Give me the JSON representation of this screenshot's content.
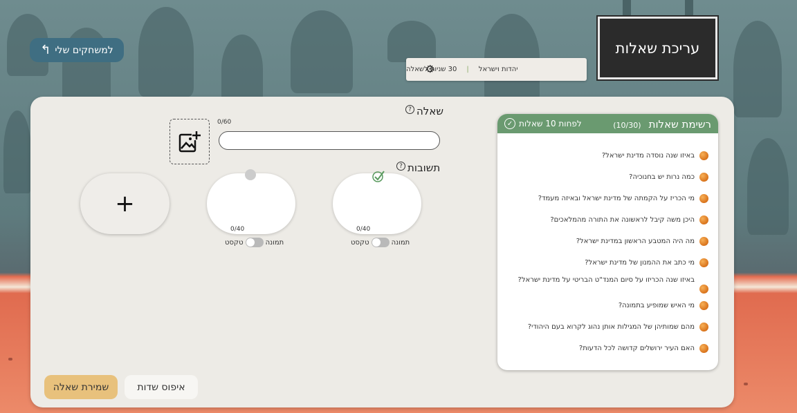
{
  "header": {
    "back_label": "למשחקים שלי",
    "title": "עריכת שאלות",
    "settings": {
      "category": "יהדות וישראל",
      "separator": "|",
      "time_per_question": "30 שניות לשאלה"
    }
  },
  "question_list": {
    "title": "רשימת שאלות",
    "count": "(10/30)",
    "minimum": "לפחות 10 שאלות",
    "items": [
      "באיזו שנה נוסדה מדינת ישראל?",
      "כמה נרות יש בחנוכיה?",
      "מי הכריז על הקמתה של מדינת ישראל ובאיזה מעמד?",
      "היכן משה קיבל לראשונה את התורה מהמלאכים?",
      "מה היה המטבע הראשון במדינת ישראל?",
      "מי כתב את ההמנון של מדינת ישראל?",
      "באיזו שנה הכריזו על סיום המנד\"ט הבריטי על מדינת ישראל?",
      "מי האיש שמופיע בתמונה?",
      "מהם שמותיהן של המגילות אותן נהוג לקרוא בעם היהודי?",
      "האם העיר ירושלים קדושה לכל הדעות?"
    ]
  },
  "editor": {
    "question_label": "שאלה",
    "question_counter": "0/60",
    "question_value": "",
    "answers_label": "תשובות",
    "help_symbol": "?",
    "answers": [
      {
        "counter": "0/40",
        "toggle_image": "תמונה",
        "toggle_text": "טקסט"
      },
      {
        "counter": "0/40",
        "toggle_image": "תמונה",
        "toggle_text": "טקסט"
      }
    ],
    "add_symbol": "+"
  },
  "actions": {
    "reset_label": "איפוס שדות",
    "save_label": "שמירת שאלה"
  }
}
